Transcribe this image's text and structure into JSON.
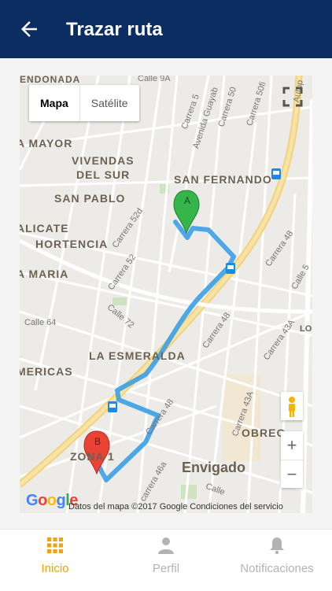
{
  "header": {
    "title": "Trazar ruta",
    "back_icon": "arrow-back-icon",
    "bg_color": "#0b2d62"
  },
  "map": {
    "type_buttons": [
      "Mapa",
      "Satélite"
    ],
    "selected_type": "Mapa",
    "labels": {
      "dondada": "ENDONADA",
      "mayor": "A MAYOR",
      "viviendas": "VIVENDAS",
      "del_sur": "DEL SUR",
      "san_fernando": "SAN FERNANDO",
      "san_pablo": "SAN PABLO",
      "alicante": "ALICATE",
      "hortencia": "HORTENCIA",
      "maria": "A MARIA",
      "esmeralda": "LA ESMERALDA",
      "americas": "MERICAS",
      "obrero": "OBREO",
      "zona1": "ZONA 1",
      "envigado": "Envigado"
    },
    "streets": {
      "calle9a": "Calle 9A",
      "carrera5": "Carrera 5",
      "avenida_guayab": "Avenida Guayab",
      "carrera50": "Carrera 50",
      "carrera50fi": "Carrera 50fi",
      "autop": "Autop",
      "carrera52d": "Carrera 52d",
      "carrera52": "Carrera 52",
      "carrera48_a": "Carrera 48",
      "carrera48_b": "Carrera 48",
      "carrera48_c": "Carrera 48",
      "calle72": "Calle 72",
      "calle64": "Calle 64",
      "carrera43a": "Carrera 43A",
      "carrera43a_b": "Carrera 43A",
      "carrera46a": "carrera 46a",
      "lo": "LO",
      "calle": "Calle",
      "calle_b": "Calle 5"
    },
    "marker_a": "A",
    "marker_b": "B",
    "zoom_in": "+",
    "zoom_out": "−",
    "attribution": "Datos del mapa ©2017 Google    Condiciones del servicio",
    "google_logo": "Google"
  },
  "bottom_nav": {
    "items": [
      {
        "label": "Inicio",
        "icon": "grid-icon",
        "active": true
      },
      {
        "label": "Perfil",
        "icon": "person-icon",
        "active": false
      },
      {
        "label": "Notificaciones",
        "icon": "bell-icon",
        "active": false
      }
    ],
    "active_color": "#f0a20d",
    "inactive_color": "#b3b3b3"
  }
}
